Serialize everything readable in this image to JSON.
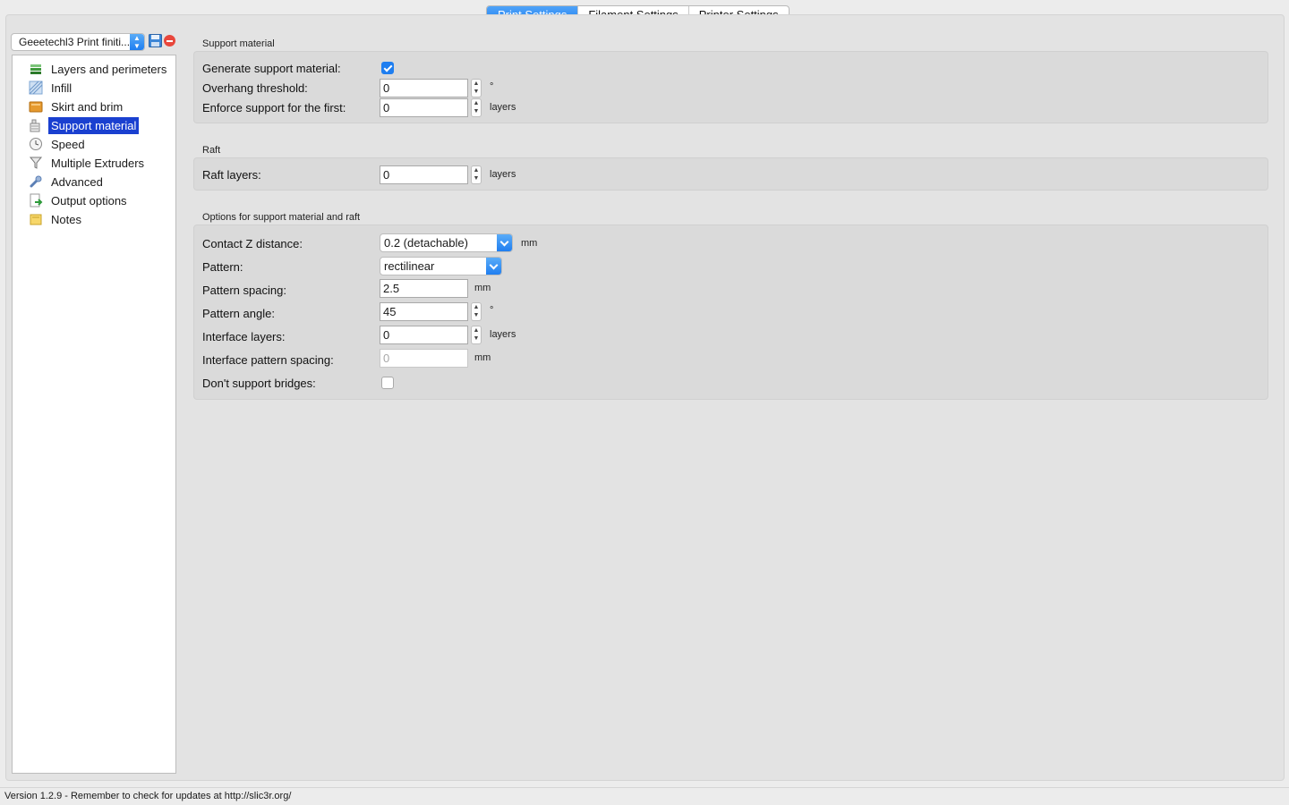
{
  "tabs": [
    {
      "label": "Print Settings",
      "active": true
    },
    {
      "label": "Filament Settings",
      "active": false
    },
    {
      "label": "Printer Settings",
      "active": false
    }
  ],
  "preset": {
    "selected": "Geeetechl3 Print finiti..."
  },
  "tree": {
    "items": [
      {
        "label": "Layers and perimeters",
        "icon": "layers-icon"
      },
      {
        "label": "Infill",
        "icon": "infill-icon"
      },
      {
        "label": "Skirt and brim",
        "icon": "box-icon"
      },
      {
        "label": "Support material",
        "icon": "building-icon",
        "selected": true
      },
      {
        "label": "Speed",
        "icon": "clock-icon"
      },
      {
        "label": "Multiple Extruders",
        "icon": "funnel-icon"
      },
      {
        "label": "Advanced",
        "icon": "wrench-icon"
      },
      {
        "label": "Output options",
        "icon": "output-icon"
      },
      {
        "label": "Notes",
        "icon": "note-icon"
      }
    ]
  },
  "support_material": {
    "title": "Support material",
    "generate_label": "Generate support material:",
    "generate_checked": true,
    "overhang_label": "Overhang threshold:",
    "overhang_value": "0",
    "overhang_unit": "°",
    "enforce_label": "Enforce support for the first:",
    "enforce_value": "0",
    "enforce_unit": "layers"
  },
  "raft": {
    "title": "Raft",
    "layers_label": "Raft layers:",
    "layers_value": "0",
    "layers_unit": "layers"
  },
  "options": {
    "title": "Options for support material and raft",
    "contact_z_label": "Contact Z distance:",
    "contact_z_value": "0.2 (detachable)",
    "contact_z_unit": "mm",
    "pattern_label": "Pattern:",
    "pattern_value": "rectilinear",
    "spacing_label": "Pattern spacing:",
    "spacing_value": "2.5",
    "spacing_unit": "mm",
    "angle_label": "Pattern angle:",
    "angle_value": "45",
    "angle_unit": "°",
    "interface_layers_label": "Interface layers:",
    "interface_layers_value": "0",
    "interface_layers_unit": "layers",
    "interface_spacing_label": "Interface pattern spacing:",
    "interface_spacing_value": "0",
    "interface_spacing_unit": "mm",
    "dont_support_label": "Don't support bridges:",
    "dont_support_checked": false
  },
  "status": {
    "text": "Version 1.2.9 - Remember to check for updates at http://slic3r.org/"
  },
  "colors": {
    "accent": "#1e7ef0",
    "selection": "#1a40d0"
  }
}
